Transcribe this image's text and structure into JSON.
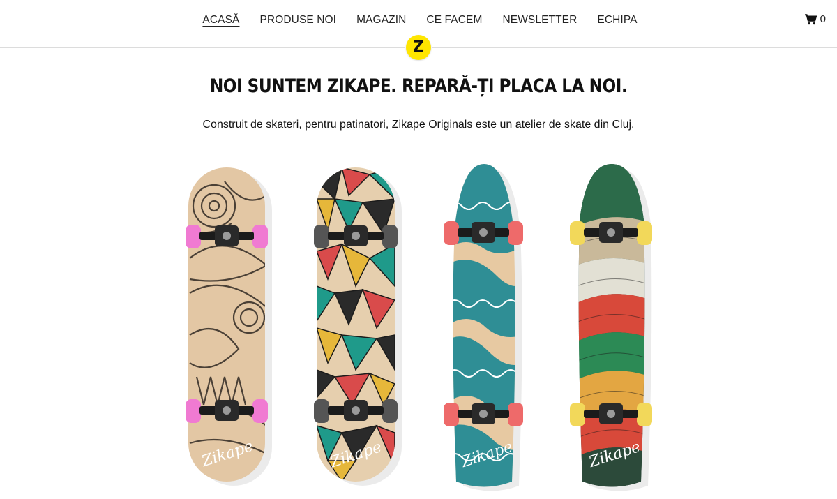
{
  "nav": {
    "items": [
      {
        "label": "ACASĂ",
        "active": true
      },
      {
        "label": "PRODUSE NOI",
        "active": false
      },
      {
        "label": "MAGAZIN",
        "active": false
      },
      {
        "label": "CE FACEM",
        "active": false
      },
      {
        "label": "NEWSLETTER",
        "active": false
      },
      {
        "label": "ECHIPA",
        "active": false
      }
    ],
    "cart_count": "0"
  },
  "logo": {
    "letter": "Z"
  },
  "hero": {
    "title": "NOI SUNTEM ZIKAPE. REPARĂ-ȚI PLACA LA NOI.",
    "subtitle": "Construit de skateri, pentru patinatori, Zikape Originals este un atelier de skate din Cluj."
  },
  "boards": [
    {
      "brand": "Zikape",
      "pattern": "doodle",
      "wheel_color": "#f07ad2",
      "deck_color": "#e3c7a4"
    },
    {
      "brand": "Zikape",
      "pattern": "triangles",
      "wheel_color": "#555555",
      "deck_color": "#e6cfae"
    },
    {
      "brand": "Zikape",
      "pattern": "waves",
      "wheel_color": "#ee6a6a",
      "deck_color": "#e7c9a2"
    },
    {
      "brand": "Zikape",
      "pattern": "rainbow-waves",
      "wheel_color": "#f2d85a",
      "deck_color": "#2c4a3a"
    }
  ],
  "colors": {
    "accent": "#ffe600",
    "text": "#111111",
    "divider": "#dcdcdc"
  }
}
